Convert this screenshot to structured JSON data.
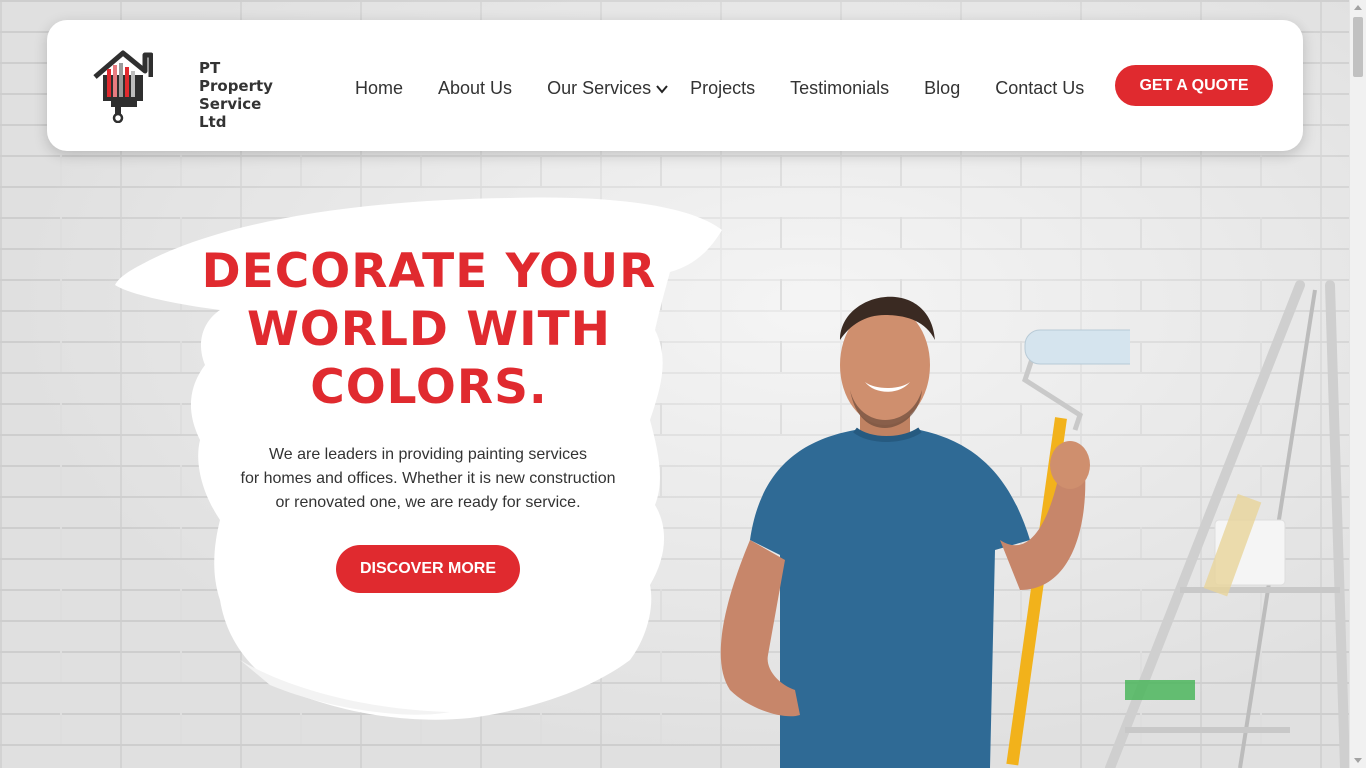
{
  "brand": {
    "name_line1": "PT Property",
    "name_line2": "Service Ltd"
  },
  "nav": {
    "items": [
      {
        "label": "Home"
      },
      {
        "label": "About Us"
      },
      {
        "label": "Our Services",
        "has_dropdown": true
      },
      {
        "label": "Projects"
      },
      {
        "label": "Testimonials"
      },
      {
        "label": "Blog"
      },
      {
        "label": "Contact Us"
      }
    ],
    "cta_label": "GET A QUOTE"
  },
  "hero": {
    "title_line1": "DECORATE YOUR",
    "title_line2": "WORLD WITH",
    "title_line3": "COLORS.",
    "desc_line1": "We are leaders in providing painting services",
    "desc_line2": "for homes and offices. Whether it is new construction",
    "desc_line3": "or renovated one, we are ready for service.",
    "button_label": "DISCOVER MORE"
  },
  "colors": {
    "accent": "#e02a2f",
    "text": "#333333",
    "background": "#ececec",
    "shirt": "#2f6a95",
    "roller_handle": "#f2b21b"
  },
  "icons": {
    "dropdown": "chevron-down-icon",
    "logo": "house-paintbrush-logo"
  }
}
